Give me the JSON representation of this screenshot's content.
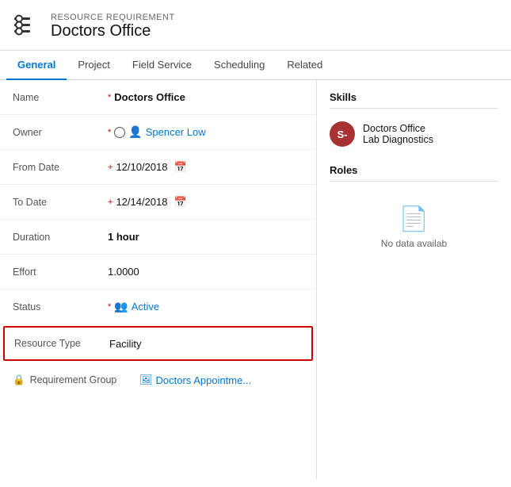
{
  "header": {
    "meta_label": "RESOURCE REQUIREMENT",
    "title": "Doctors Office"
  },
  "tabs": [
    {
      "id": "general",
      "label": "General",
      "active": true
    },
    {
      "id": "project",
      "label": "Project",
      "active": false
    },
    {
      "id": "field-service",
      "label": "Field Service",
      "active": false
    },
    {
      "id": "scheduling",
      "label": "Scheduling",
      "active": false
    },
    {
      "id": "related",
      "label": "Related",
      "active": false
    }
  ],
  "fields": {
    "name_label": "Name",
    "name_value": "Doctors Office",
    "owner_label": "Owner",
    "owner_value": "Spencer Low",
    "from_date_label": "From Date",
    "from_date_value": "12/10/2018",
    "to_date_label": "To Date",
    "to_date_value": "12/14/2018",
    "duration_label": "Duration",
    "duration_value": "1 hour",
    "effort_label": "Effort",
    "effort_value": "1.0000",
    "status_label": "Status",
    "status_value": "Active",
    "resource_type_label": "Resource Type",
    "resource_type_value": "Facility",
    "req_group_label": "Requirement Group",
    "req_group_icon": "🖼",
    "req_group_value": "Doctors Appointme..."
  },
  "skills_section": {
    "title": "Skills",
    "item": {
      "avatar_text": "S-",
      "name_line1": "Doctors Office",
      "name_line2": "Lab Diagnostics"
    }
  },
  "roles_section": {
    "title": "Roles",
    "no_data_text": "No data availab"
  }
}
